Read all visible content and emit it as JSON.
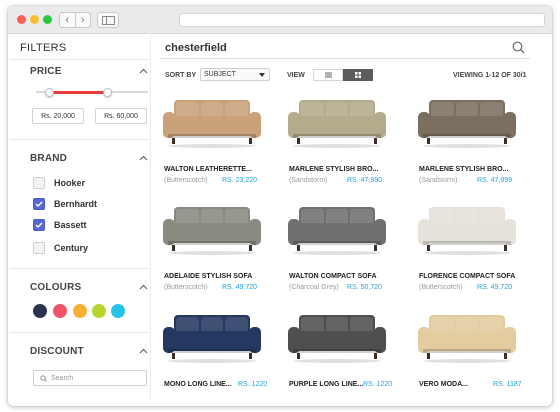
{
  "browser": {
    "back": "‹",
    "forward": "›"
  },
  "sidebar": {
    "title": "FILTERS",
    "price": {
      "title": "PRICE",
      "min": "Rs. 20,000",
      "max": "Rs. 60,000",
      "range_fraction": [
        0.12,
        0.64
      ]
    },
    "brand": {
      "title": "BRAND",
      "items": [
        {
          "label": "Hooker",
          "checked": false
        },
        {
          "label": "Bernhardt",
          "checked": true
        },
        {
          "label": "Bassett",
          "checked": true
        },
        {
          "label": "Century",
          "checked": false
        }
      ]
    },
    "colours": {
      "title": "COLOURS",
      "swatches": [
        "#2b3350",
        "#f0546a",
        "#f6b133",
        "#b7d531",
        "#24c4e7"
      ]
    },
    "discount": {
      "title": "DISCOUNT",
      "search_placeholder": "Search"
    }
  },
  "main": {
    "query": "chesterfield",
    "sort_by_label": "SORT BY",
    "sort_by_value": "SUBJECT",
    "view_label": "VIEW",
    "viewing": "VIEWING 1-12 OF 30/1",
    "products": [
      {
        "name": "WALTON LEATHERETTE...",
        "color": "(Butterscotch)",
        "price": "RS. 23,220",
        "fill": "#c9a27a"
      },
      {
        "name": "MARLENE STYLISH BRO...",
        "color": "(Sandstorm)",
        "price": "RS. 47,990",
        "fill": "#b3ab8c"
      },
      {
        "name": "MARLENE STYLISH BRO...",
        "color": "(Sandstorm)",
        "price": "RS. 47,999",
        "fill": "#7b6f60"
      },
      {
        "name": "ADELAIDE STYLISH SOFA",
        "color": "(Butterscotch)",
        "price": "RS. 49,720",
        "fill": "#8a8a80"
      },
      {
        "name": "WALTON COMPACT SOFA",
        "color": "(Charcoal Grey)",
        "price": "RS. 50,720",
        "fill": "#6f7070"
      },
      {
        "name": "FLORENCE COMPACT SOFA",
        "color": "(Butterscotch)",
        "price": "RS. 49,720",
        "fill": "#e6e2da"
      },
      {
        "name": "MONO LONG LINE...",
        "color": "",
        "price": "RS. 1220",
        "fill": "#243861"
      },
      {
        "name": "PURPLE LONG LINE...",
        "color": "",
        "price": "RS. 1220",
        "fill": "#4f4f52"
      },
      {
        "name": "VERO MODA...",
        "color": "",
        "price": "RS. 1187",
        "fill": "#e3cc9f"
      }
    ]
  }
}
